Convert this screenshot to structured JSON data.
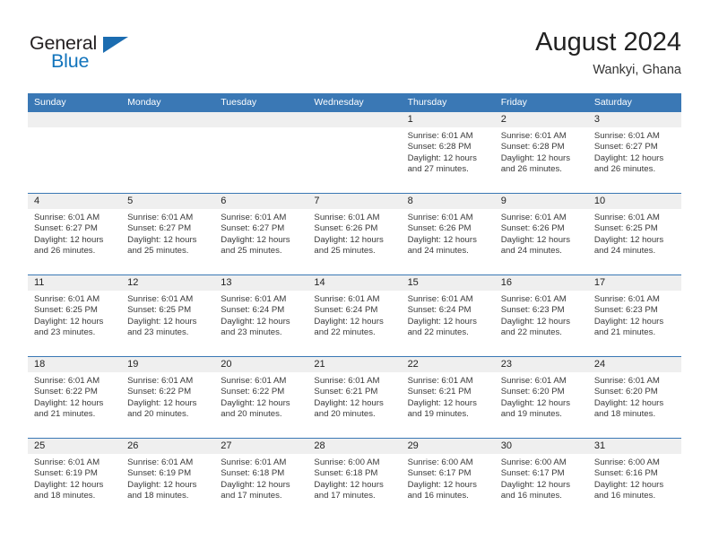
{
  "logo": {
    "word_top": "General",
    "word_bottom": "Blue",
    "flag_icon": "blue-triangle-flag",
    "brand_color": "#1274bc"
  },
  "header": {
    "title": "August 2024",
    "location": "Wankyi, Ghana"
  },
  "theme": {
    "header_bar": "#3a78b5",
    "day_strip": "#efefef",
    "separator": "#3a78b5",
    "text": "#222222"
  },
  "calendar": {
    "weekday_headers": [
      "Sunday",
      "Monday",
      "Tuesday",
      "Wednesday",
      "Thursday",
      "Friday",
      "Saturday"
    ],
    "weeks": [
      [
        {
          "day": "",
          "blank": true
        },
        {
          "day": "",
          "blank": true
        },
        {
          "day": "",
          "blank": true
        },
        {
          "day": "",
          "blank": true
        },
        {
          "day": "1",
          "sunrise": "Sunrise: 6:01 AM",
          "sunset": "Sunset: 6:28 PM",
          "daylight": "Daylight: 12 hours and 27 minutes."
        },
        {
          "day": "2",
          "sunrise": "Sunrise: 6:01 AM",
          "sunset": "Sunset: 6:28 PM",
          "daylight": "Daylight: 12 hours and 26 minutes."
        },
        {
          "day": "3",
          "sunrise": "Sunrise: 6:01 AM",
          "sunset": "Sunset: 6:27 PM",
          "daylight": "Daylight: 12 hours and 26 minutes."
        }
      ],
      [
        {
          "day": "4",
          "sunrise": "Sunrise: 6:01 AM",
          "sunset": "Sunset: 6:27 PM",
          "daylight": "Daylight: 12 hours and 26 minutes."
        },
        {
          "day": "5",
          "sunrise": "Sunrise: 6:01 AM",
          "sunset": "Sunset: 6:27 PM",
          "daylight": "Daylight: 12 hours and 25 minutes."
        },
        {
          "day": "6",
          "sunrise": "Sunrise: 6:01 AM",
          "sunset": "Sunset: 6:27 PM",
          "daylight": "Daylight: 12 hours and 25 minutes."
        },
        {
          "day": "7",
          "sunrise": "Sunrise: 6:01 AM",
          "sunset": "Sunset: 6:26 PM",
          "daylight": "Daylight: 12 hours and 25 minutes."
        },
        {
          "day": "8",
          "sunrise": "Sunrise: 6:01 AM",
          "sunset": "Sunset: 6:26 PM",
          "daylight": "Daylight: 12 hours and 24 minutes."
        },
        {
          "day": "9",
          "sunrise": "Sunrise: 6:01 AM",
          "sunset": "Sunset: 6:26 PM",
          "daylight": "Daylight: 12 hours and 24 minutes."
        },
        {
          "day": "10",
          "sunrise": "Sunrise: 6:01 AM",
          "sunset": "Sunset: 6:25 PM",
          "daylight": "Daylight: 12 hours and 24 minutes."
        }
      ],
      [
        {
          "day": "11",
          "sunrise": "Sunrise: 6:01 AM",
          "sunset": "Sunset: 6:25 PM",
          "daylight": "Daylight: 12 hours and 23 minutes."
        },
        {
          "day": "12",
          "sunrise": "Sunrise: 6:01 AM",
          "sunset": "Sunset: 6:25 PM",
          "daylight": "Daylight: 12 hours and 23 minutes."
        },
        {
          "day": "13",
          "sunrise": "Sunrise: 6:01 AM",
          "sunset": "Sunset: 6:24 PM",
          "daylight": "Daylight: 12 hours and 23 minutes."
        },
        {
          "day": "14",
          "sunrise": "Sunrise: 6:01 AM",
          "sunset": "Sunset: 6:24 PM",
          "daylight": "Daylight: 12 hours and 22 minutes."
        },
        {
          "day": "15",
          "sunrise": "Sunrise: 6:01 AM",
          "sunset": "Sunset: 6:24 PM",
          "daylight": "Daylight: 12 hours and 22 minutes."
        },
        {
          "day": "16",
          "sunrise": "Sunrise: 6:01 AM",
          "sunset": "Sunset: 6:23 PM",
          "daylight": "Daylight: 12 hours and 22 minutes."
        },
        {
          "day": "17",
          "sunrise": "Sunrise: 6:01 AM",
          "sunset": "Sunset: 6:23 PM",
          "daylight": "Daylight: 12 hours and 21 minutes."
        }
      ],
      [
        {
          "day": "18",
          "sunrise": "Sunrise: 6:01 AM",
          "sunset": "Sunset: 6:22 PM",
          "daylight": "Daylight: 12 hours and 21 minutes."
        },
        {
          "day": "19",
          "sunrise": "Sunrise: 6:01 AM",
          "sunset": "Sunset: 6:22 PM",
          "daylight": "Daylight: 12 hours and 20 minutes."
        },
        {
          "day": "20",
          "sunrise": "Sunrise: 6:01 AM",
          "sunset": "Sunset: 6:22 PM",
          "daylight": "Daylight: 12 hours and 20 minutes."
        },
        {
          "day": "21",
          "sunrise": "Sunrise: 6:01 AM",
          "sunset": "Sunset: 6:21 PM",
          "daylight": "Daylight: 12 hours and 20 minutes."
        },
        {
          "day": "22",
          "sunrise": "Sunrise: 6:01 AM",
          "sunset": "Sunset: 6:21 PM",
          "daylight": "Daylight: 12 hours and 19 minutes."
        },
        {
          "day": "23",
          "sunrise": "Sunrise: 6:01 AM",
          "sunset": "Sunset: 6:20 PM",
          "daylight": "Daylight: 12 hours and 19 minutes."
        },
        {
          "day": "24",
          "sunrise": "Sunrise: 6:01 AM",
          "sunset": "Sunset: 6:20 PM",
          "daylight": "Daylight: 12 hours and 18 minutes."
        }
      ],
      [
        {
          "day": "25",
          "sunrise": "Sunrise: 6:01 AM",
          "sunset": "Sunset: 6:19 PM",
          "daylight": "Daylight: 12 hours and 18 minutes."
        },
        {
          "day": "26",
          "sunrise": "Sunrise: 6:01 AM",
          "sunset": "Sunset: 6:19 PM",
          "daylight": "Daylight: 12 hours and 18 minutes."
        },
        {
          "day": "27",
          "sunrise": "Sunrise: 6:01 AM",
          "sunset": "Sunset: 6:18 PM",
          "daylight": "Daylight: 12 hours and 17 minutes."
        },
        {
          "day": "28",
          "sunrise": "Sunrise: 6:00 AM",
          "sunset": "Sunset: 6:18 PM",
          "daylight": "Daylight: 12 hours and 17 minutes."
        },
        {
          "day": "29",
          "sunrise": "Sunrise: 6:00 AM",
          "sunset": "Sunset: 6:17 PM",
          "daylight": "Daylight: 12 hours and 16 minutes."
        },
        {
          "day": "30",
          "sunrise": "Sunrise: 6:00 AM",
          "sunset": "Sunset: 6:17 PM",
          "daylight": "Daylight: 12 hours and 16 minutes."
        },
        {
          "day": "31",
          "sunrise": "Sunrise: 6:00 AM",
          "sunset": "Sunset: 6:16 PM",
          "daylight": "Daylight: 12 hours and 16 minutes."
        }
      ]
    ]
  }
}
